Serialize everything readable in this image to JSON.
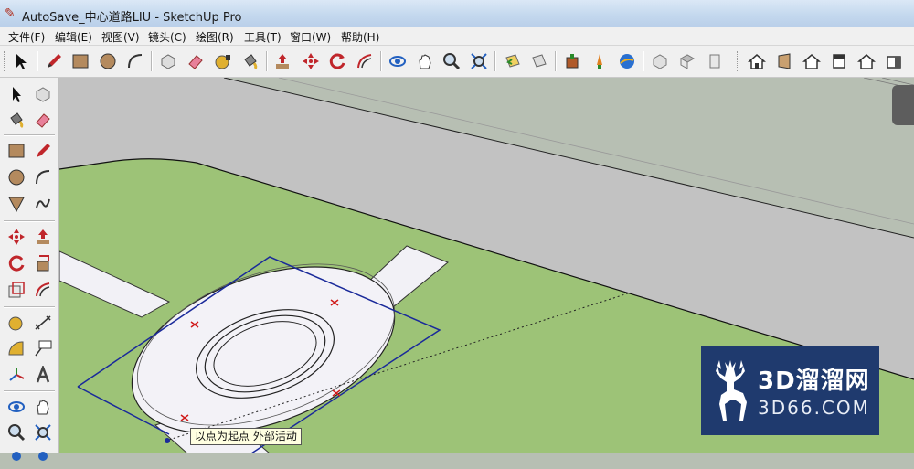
{
  "window": {
    "title": "AutoSave_中心道路LIU - SketchUp Pro"
  },
  "menu": {
    "file": "文件(F)",
    "edit": "编辑(E)",
    "view": "视图(V)",
    "camera": "镜头(C)",
    "draw": "绘图(R)",
    "tools": "工具(T)",
    "window": "窗口(W)",
    "help": "帮助(H)"
  },
  "toolbar": {
    "icons": [
      "select-icon",
      "pencil-icon",
      "rectangle-icon",
      "circle-icon",
      "arc-icon",
      "make-component-icon",
      "eraser-icon",
      "tape-measure-icon",
      "paint-bucket-icon",
      "push-pull-icon",
      "move-icon",
      "rotate-icon",
      "offset-icon",
      "orbit-icon",
      "pan-icon",
      "zoom-icon",
      "zoom-extents-icon",
      "previous-view-icon",
      "next-view-icon",
      "get-models-icon",
      "share-model-icon",
      "google-earth-icon",
      "views-iso-icon",
      "views-top-icon",
      "views-front-icon",
      "views-right-icon",
      "views-back-icon",
      "views-left-icon"
    ]
  },
  "canvas": {
    "tooltip": "以点为起点 外部活动"
  },
  "watermark": {
    "title": "3D溜溜网",
    "url": "3D66.COM"
  },
  "colors": {
    "grass": "#9dc377",
    "road": "#c3c3c3",
    "sky": "#b7bfb3",
    "selection": "#1a2a9a"
  }
}
